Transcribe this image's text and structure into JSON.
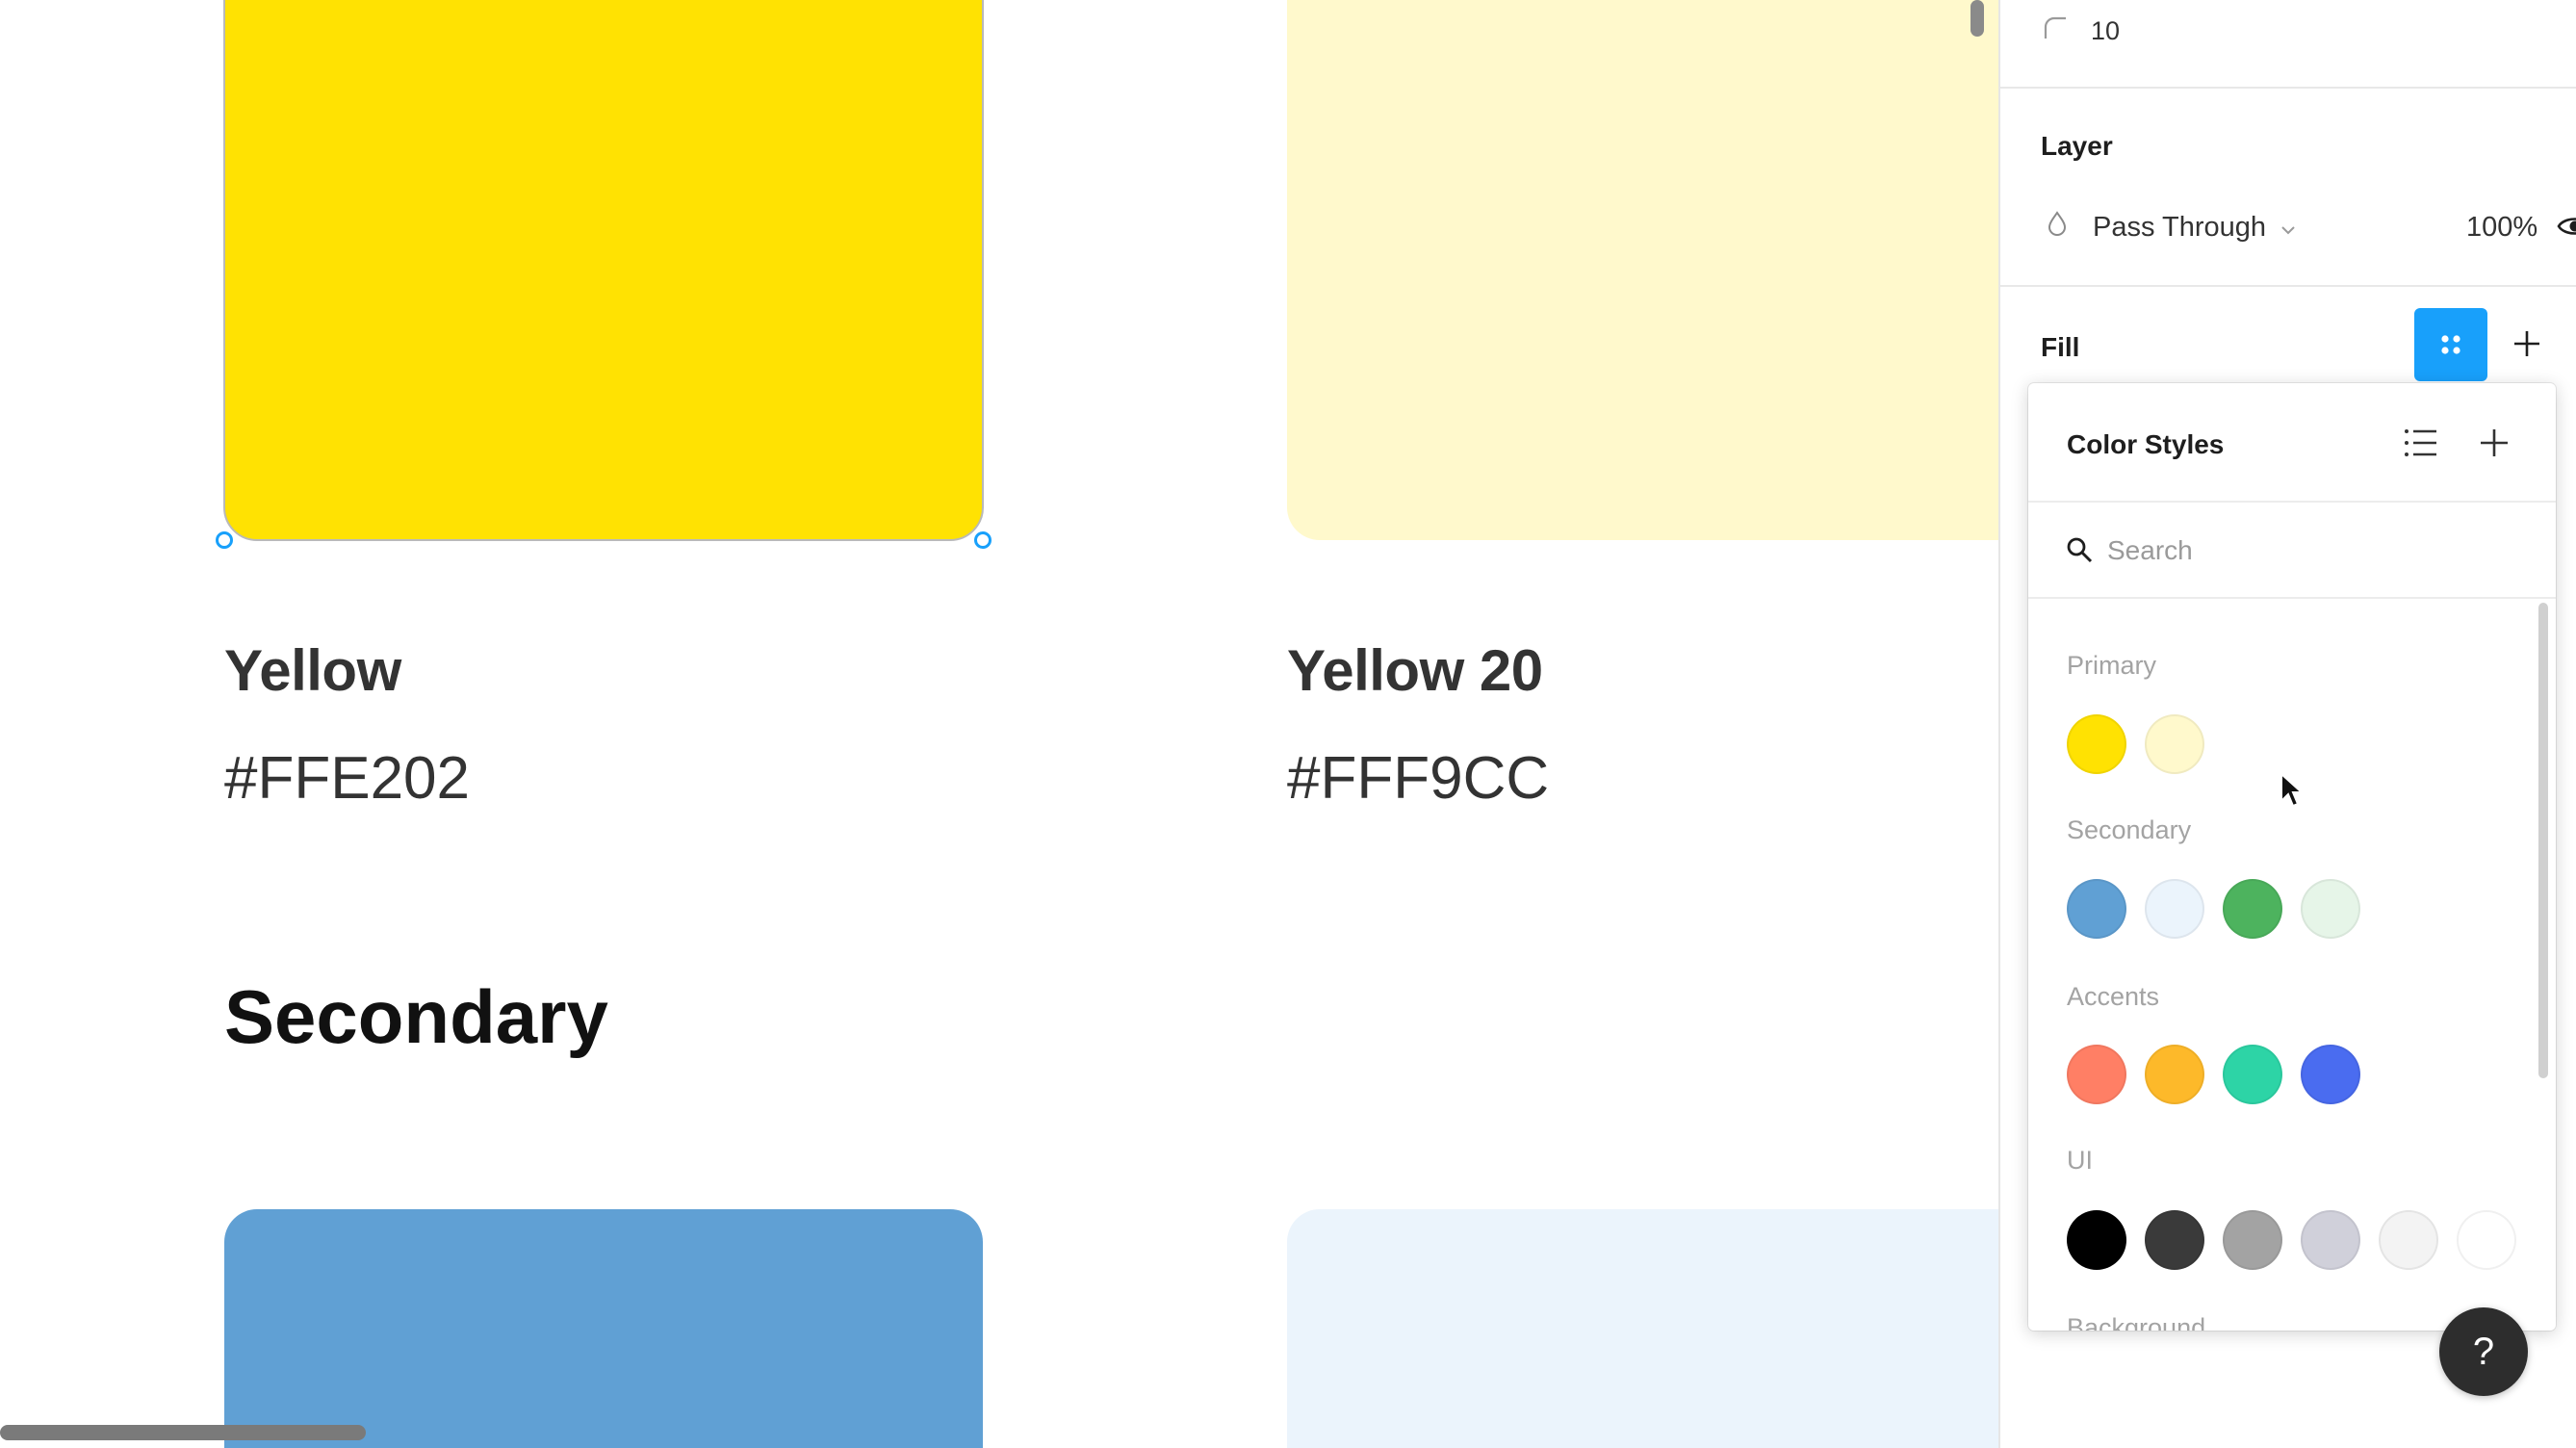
{
  "canvas": {
    "swatches": [
      {
        "name": "Yellow",
        "hex": "#FFE202",
        "color": "#FFE202"
      },
      {
        "name": "Yellow 20",
        "hex": "#FFF9CC",
        "color": "#FFF9CC"
      }
    ],
    "section_heading": "Secondary",
    "secondary_swatch_colors": [
      "#60A0D4",
      "#EBF4FC"
    ]
  },
  "panel": {
    "corner_radius_value": "10",
    "layer": {
      "title": "Layer",
      "blend_mode": "Pass Through",
      "opacity": "100%"
    },
    "fill": {
      "title": "Fill"
    },
    "color_styles": {
      "title": "Color Styles",
      "search_placeholder": "Search",
      "groups": [
        {
          "label": "Primary",
          "colors": [
            "#FFE202",
            "#FFF9CC"
          ]
        },
        {
          "label": "Secondary",
          "colors": [
            "#60A0D4",
            "#EBF4FC",
            "#4DB35E",
            "#E6F5E8"
          ]
        },
        {
          "label": "Accents",
          "colors": [
            "#FF7F65",
            "#FDB92A",
            "#2DD4A6",
            "#4A6CF0"
          ]
        },
        {
          "label": "UI",
          "colors": [
            "#000000",
            "#3A3A3A",
            "#A3A3A3",
            "#D0D0DA",
            "#F3F3F3",
            "#FFFFFF"
          ]
        },
        {
          "label": "Background",
          "colors": []
        }
      ]
    },
    "help_label": "?"
  },
  "colors": {
    "accent": "#18A0FB",
    "selection_handle": "#18A0FB"
  }
}
